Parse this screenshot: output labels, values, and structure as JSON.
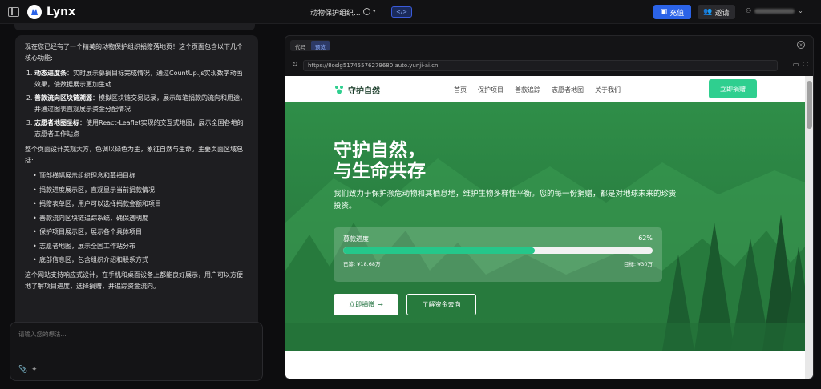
{
  "topbar": {
    "brand": "Lynx",
    "project_title": "动物保护组织...",
    "recharge_label": "充值",
    "invite_label": "邀请"
  },
  "chat": {
    "intro": "现在您已经有了一个精美的动物保护组织捐赠落地页！这个页面包含以下几个核心功能:",
    "features": [
      {
        "title": "动态进度条",
        "desc": "：实时展示募捐目标完成情况，通过CountUp.js实现数字动画效果，使数据展示更加生动"
      },
      {
        "title": "善款流向区块链溯源",
        "desc": "：模拟区块链交易记录，展示每笔捐款的流向和用途，并通过图表直观展示资金分配情况"
      },
      {
        "title": "志愿者地图坐标",
        "desc": "：使用React-Leaflet实现的交互式地图，展示全国各地的志愿者工作站点"
      }
    ],
    "summary": "整个页面设计美观大方，色调以绿色为主，象征自然与生命。主要页面区域包括:",
    "sections": [
      "顶部横幅展示组织理念和募捐目标",
      "捐款进度展示区，直观显示当前捐款情况",
      "捐赠表单区，用户可以选择捐款金额和项目",
      "善款流向区块链追踪系统，确保透明度",
      "保护项目展示区，展示各个具体项目",
      "志愿者地图，展示全国工作站分布",
      "底部信息区，包含组织介绍和联系方式"
    ],
    "closing": "这个网站支持响应式设计，在手机和桌面设备上都能良好展示，用户可以方便地了解项目进度，选择捐赠，并追踪资金流向。",
    "input_placeholder": "请输入您的想法..."
  },
  "preview": {
    "tab_code": "代码",
    "tab_preview": "预览",
    "url": "https://8oslg51745576279680.auto.yunji-ai.cn"
  },
  "site": {
    "logo_text": "守护自然",
    "nav": [
      "首页",
      "保护项目",
      "善款追踪",
      "志愿者地图",
      "关于我们"
    ],
    "donate_top": "立即捐赠",
    "hero_title_line1": "守护自然，",
    "hero_title_line2": "与生命共存",
    "hero_desc": "我们致力于保护濒危动物和其栖息地，维护生物多样性平衡。您的每一份捐赠，都是对地球未来的珍贵投资。",
    "progress": {
      "label": "募款进度",
      "percent_text": "62%",
      "fraction": 0.62,
      "raised": "已筹: ¥18.68万",
      "goal": "目标: ¥30万"
    },
    "btn_donate": "立即捐赠",
    "btn_funds": "了解资金去向"
  },
  "colors": {
    "accent_blue": "#2b63e8",
    "site_green": "#2fcf8f",
    "hero_green": "#2b8343"
  }
}
